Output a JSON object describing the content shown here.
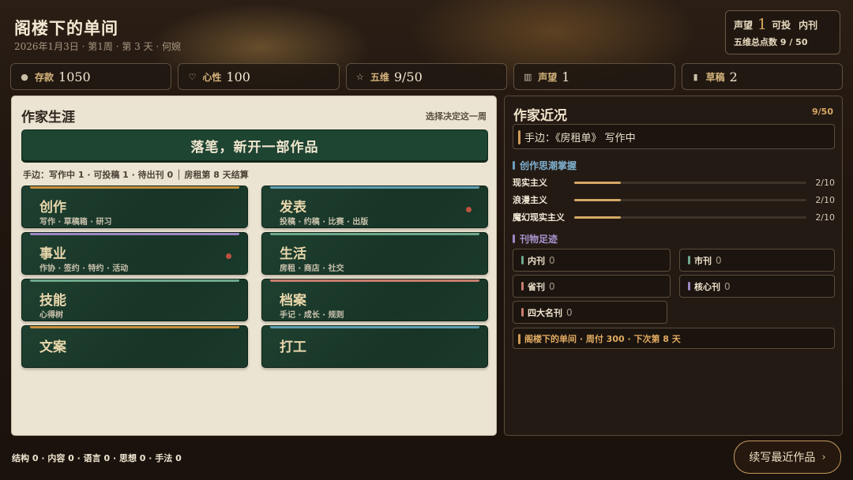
{
  "header": {
    "title": "阁楼下的单间",
    "subtitle": "2026年1月3日 · 第1周 · 第 3 天 · 何婉"
  },
  "reputation_box": {
    "label": "声望",
    "value": "1",
    "submit_label": "可投",
    "submit_target": "内刊",
    "five_dim_label": "五维总点数 9 / 50"
  },
  "stats": [
    {
      "icon": "coin-icon",
      "glyph": "●",
      "label": "存款",
      "value": "1050"
    },
    {
      "icon": "heart-icon",
      "glyph": "♡",
      "label": "心性",
      "value": "100"
    },
    {
      "icon": "star-icon",
      "glyph": "☆",
      "label": "五维",
      "value": "9/50"
    },
    {
      "icon": "book-icon",
      "glyph": "▥",
      "label": "声望",
      "value": "1"
    },
    {
      "icon": "draft-icon",
      "glyph": "▮",
      "label": "草稿",
      "value": "2"
    }
  ],
  "career": {
    "title": "作家生涯",
    "hint": "选择决定这一周",
    "primary_action": "落笔，新开一部作品",
    "status": "手边：写作中 1 · 可投稿 1 · 待出刊 0 │ 房租第 8 天结算",
    "tiles": [
      {
        "title": "创作",
        "sub": "写作 · 草稿箱 · 研习",
        "color": "#c8923f",
        "dot": false
      },
      {
        "title": "发表",
        "sub": "投稿 · 约稿 · 比赛 · 出版",
        "color": "#5f9fb4",
        "dot": true
      },
      {
        "title": "事业",
        "sub": "作协 · 签约 · 特约 · 活动",
        "color": "#9c86c4",
        "dot": true
      },
      {
        "title": "生活",
        "sub": "房租 · 商店 · 社交",
        "color": "#6fa88c",
        "dot": false
      },
      {
        "title": "技能",
        "sub": "心得树",
        "color": "#6fa88c",
        "dot": false
      },
      {
        "title": "档案",
        "sub": "手记 · 成长 · 规则",
        "color": "#c77d6e",
        "dot": false
      },
      {
        "title": "文案",
        "sub": "",
        "color": "#c8923f",
        "dot": false
      },
      {
        "title": "打工",
        "sub": "",
        "color": "#5f9fb4",
        "dot": false
      }
    ]
  },
  "status_panel": {
    "title": "作家近况",
    "count": "9/50",
    "current": "手边：《房租单》 写作中",
    "trends_title": "创作思潮掌握",
    "trends_color": "#6a9fc0",
    "trends": [
      {
        "name": "现实主义",
        "value": "2/10",
        "progress": 0.2
      },
      {
        "name": "浪漫主义",
        "value": "2/10",
        "progress": 0.2
      },
      {
        "name": "魔幻现实主义",
        "value": "2/10",
        "progress": 0.2
      }
    ],
    "magazines_title": "刊物足迹",
    "magazines_color": "#9c86c4",
    "magazines": [
      {
        "name": "内刊",
        "value": "0",
        "color": "#6fa88c"
      },
      {
        "name": "市刊",
        "value": "0",
        "color": "#6fa88c"
      },
      {
        "name": "省刊",
        "value": "0",
        "color": "#c77d6e"
      },
      {
        "name": "核心刊",
        "value": "0",
        "color": "#9c86c4"
      },
      {
        "name": "四大名刊",
        "value": "0",
        "color": "#c77d6e"
      }
    ],
    "rent": "阁楼下的单间 · 周付 300 · 下次第 8 天"
  },
  "footer": {
    "attributes": "结构 0 · 内容 0 · 语言 0 · 思想 0 · 手法 0",
    "continue_label": "续写最近作品",
    "continue_icon": "chevron-right-icon"
  }
}
